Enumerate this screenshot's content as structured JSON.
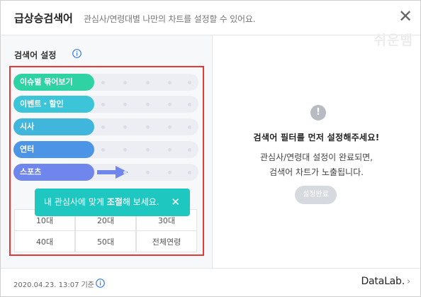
{
  "header": {
    "title": "급상승검색어",
    "subtitle": "관심사/연령대별 나만의 차트를 설정할 수 있어요.",
    "close_label": "✕"
  },
  "watermark": "쉬운뱀",
  "left_panel": {
    "section_title": "검색어 설정",
    "categories": [
      {
        "label": "이슈별 묶어보기",
        "color": "#2fd3a3"
      },
      {
        "label": "이벤트・할인",
        "color": "#3cc4d8"
      },
      {
        "label": "시사",
        "color": "#40b6dc"
      },
      {
        "label": "연터",
        "color": "#4c95e6"
      },
      {
        "label": "스포츠",
        "color": "#6f86ec"
      }
    ],
    "tooltip": {
      "text_prefix": "내 관심사에 맞게 ",
      "text_bold": "조절",
      "text_suffix": "해 보세요.",
      "close_label": "✕"
    },
    "ages": [
      "10대",
      "20대",
      "30대",
      "40대",
      "50대",
      "전체연령"
    ]
  },
  "right_panel": {
    "message_title": "검색어 필터를 먼저 설정해주세요!",
    "message_line1": "관심사/연령대 설정이 완료되면,",
    "message_line2": "검색어 차트가 노출됩니다.",
    "done_button": "설정완료"
  },
  "footer": {
    "date": "2020.04.23. 13:07 기준",
    "brand": "DataLab."
  }
}
